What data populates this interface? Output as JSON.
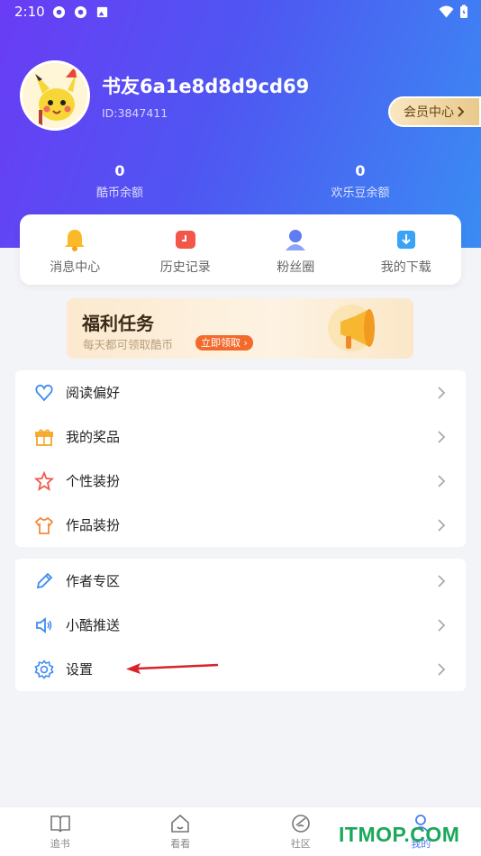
{
  "status_bar": {
    "time": "2:10"
  },
  "profile": {
    "username": "书友6a1e8d8d9cd69",
    "user_id": "ID:3847411",
    "vip_button": "会员中心",
    "stats": [
      {
        "value": "0",
        "label": "酷币余额"
      },
      {
        "value": "0",
        "label": "欢乐豆余额"
      }
    ]
  },
  "quick_actions": [
    {
      "label": "消息中心",
      "icon": "bell-icon"
    },
    {
      "label": "历史记录",
      "icon": "history-icon"
    },
    {
      "label": "粉丝圈",
      "icon": "fans-icon"
    },
    {
      "label": "我的下载",
      "icon": "download-icon"
    }
  ],
  "banner": {
    "title": "福利任务",
    "subtitle": "每天都可领取酷币",
    "button": "立即领取"
  },
  "menu_group_1": [
    {
      "label": "阅读偏好",
      "icon": "heart-icon"
    },
    {
      "label": "我的奖品",
      "icon": "gift-icon"
    },
    {
      "label": "个性装扮",
      "icon": "star-icon"
    },
    {
      "label": "作品装扮",
      "icon": "shirt-icon"
    }
  ],
  "menu_group_2": [
    {
      "label": "作者专区",
      "icon": "pen-icon"
    },
    {
      "label": "小酷推送",
      "icon": "speaker-icon"
    },
    {
      "label": "设置",
      "icon": "gear-icon"
    }
  ],
  "tab_bar": [
    {
      "label": "追书",
      "icon": "book-icon"
    },
    {
      "label": "看看",
      "icon": "home-icon"
    },
    {
      "label": "社区",
      "icon": "community-icon"
    },
    {
      "label": "我的",
      "icon": "person-icon",
      "active": true
    }
  ],
  "watermark": "ITMOP.COM",
  "colors": {
    "accent": "#4a7bf0",
    "header_start": "#6a3cf5",
    "header_end": "#3a8cf3",
    "orange": "#f26a2c"
  }
}
